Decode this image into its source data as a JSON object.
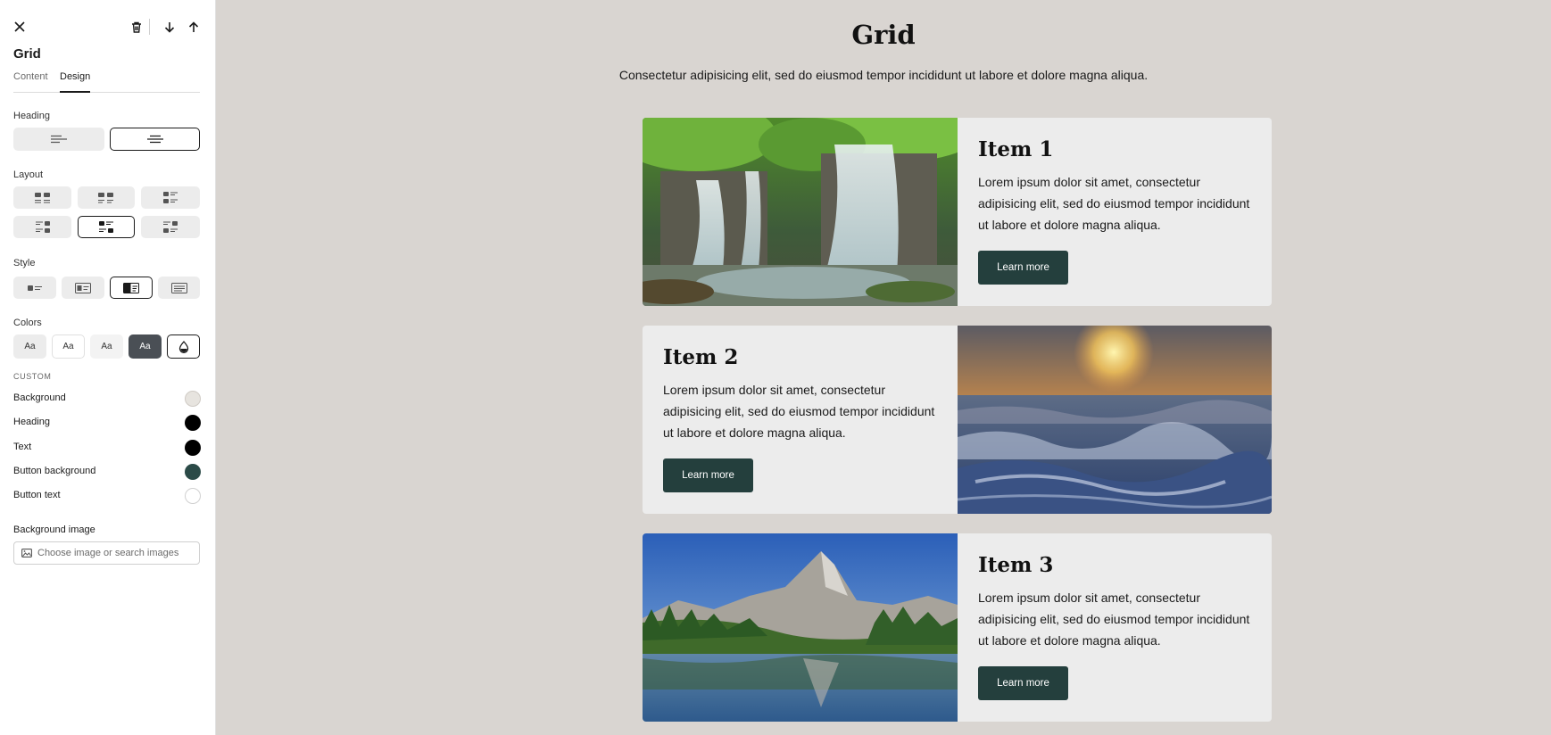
{
  "sidebar": {
    "title": "Grid",
    "tabs": [
      {
        "label": "Content"
      },
      {
        "label": "Design"
      }
    ],
    "active_tab": "Design",
    "heading_label": "Heading",
    "heading_options": [
      "align-left-icon",
      "align-center-icon"
    ],
    "heading_selected": 1,
    "layout_label": "Layout",
    "layout_selected": 4,
    "style_label": "Style",
    "style_selected": 2,
    "colors_label": "Colors",
    "color_swatches": [
      {
        "label": "Aa",
        "bg": "#ececec",
        "fg": "#333333"
      },
      {
        "label": "Aa",
        "bg": "#ffffff",
        "fg": "#333333"
      },
      {
        "label": "Aa",
        "bg": "#f3f3f3",
        "fg": "#333333"
      },
      {
        "label": "Aa",
        "bg": "#4a4f55",
        "fg": "#ffffff"
      }
    ],
    "custom_label": "CUSTOM",
    "custom_colors": [
      {
        "label": "Background",
        "color": "#e7e4df"
      },
      {
        "label": "Heading",
        "color": "#000000"
      },
      {
        "label": "Text",
        "color": "#000000"
      },
      {
        "label": "Button background",
        "color": "#2b4a47"
      },
      {
        "label": "Button text",
        "color": "#ffffff"
      }
    ],
    "background_image_label": "Background image",
    "background_image_placeholder": "Choose image or search images"
  },
  "main": {
    "title": "Grid",
    "subtitle": "Consectetur adipisicing elit, sed do eiusmod tempor incididunt ut labore et dolore magna aliqua.",
    "items": [
      {
        "title": "Item 1",
        "text": "Lorem ipsum dolor sit amet, consectetur adipisicing elit, sed do eiusmod tempor incididunt ut labore et dolore magna aliqua.",
        "button": "Learn more",
        "image": "waterfall"
      },
      {
        "title": "Item 2",
        "text": "Lorem ipsum dolor sit amet, consectetur adipisicing elit, sed do eiusmod tempor incididunt ut labore et dolore magna aliqua.",
        "button": "Learn more",
        "image": "ocean-sunset"
      },
      {
        "title": "Item 3",
        "text": "Lorem ipsum dolor sit amet, consectetur adipisicing elit, sed do eiusmod tempor incididunt ut labore et dolore magna aliqua.",
        "button": "Learn more",
        "image": "mountain-lake"
      }
    ]
  },
  "colors": {
    "canvas_bg": "#d9d5d1",
    "card_bg": "#ececec",
    "button_bg": "#243f3d",
    "button_text": "#ffffff"
  }
}
